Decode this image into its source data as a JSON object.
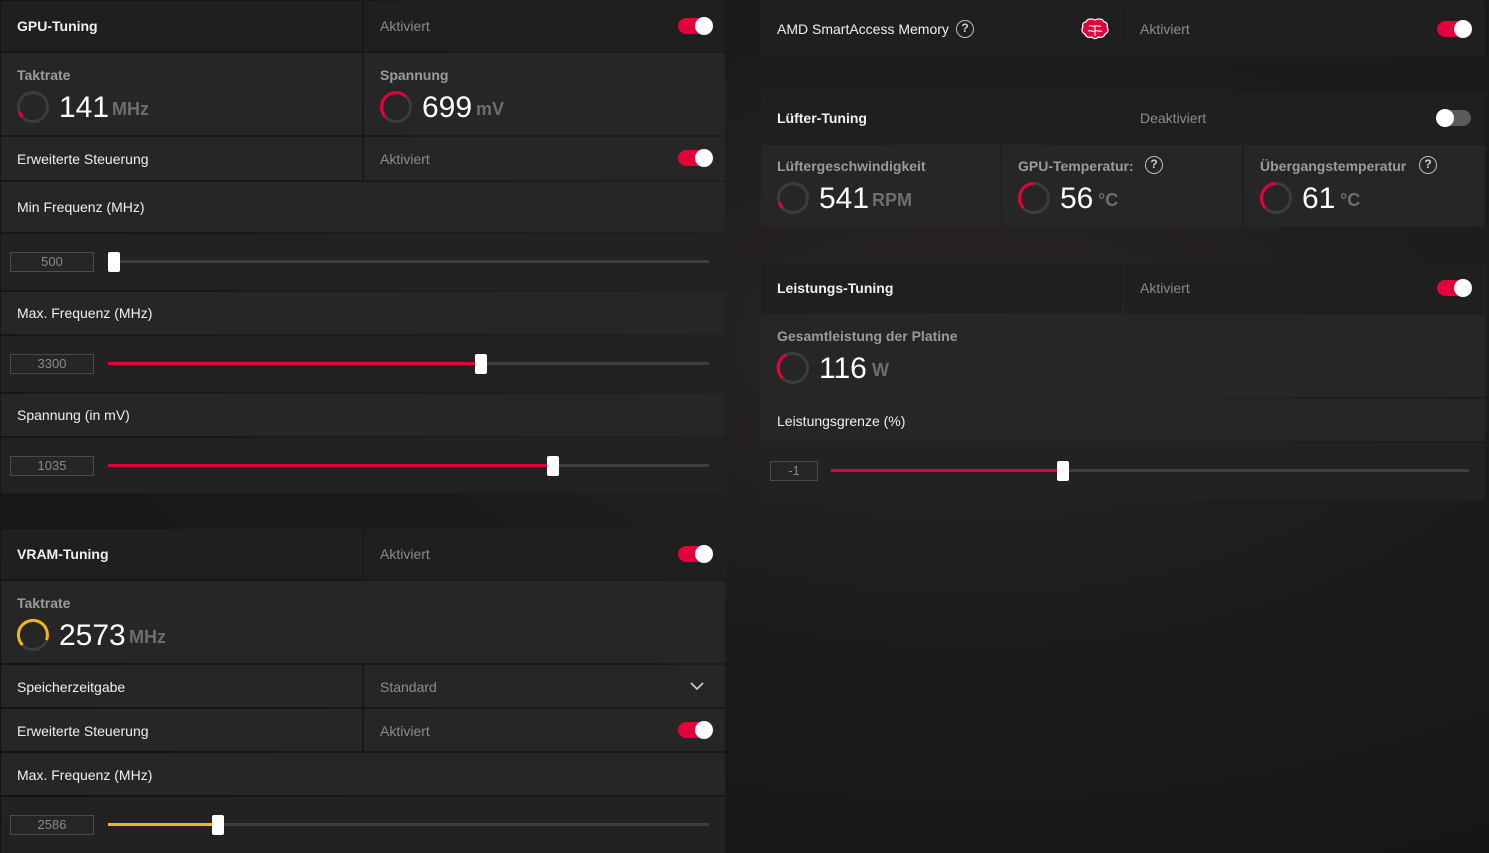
{
  "colors": {
    "accent_red": "#e4003a",
    "accent_yellow": "#f2b51d",
    "panel": "#262626"
  },
  "gpu_tuning": {
    "title": "GPU-Tuning",
    "status": "Aktiviert",
    "enabled": true,
    "clock": {
      "title": "Taktrate",
      "value": "141",
      "unit": "MHz"
    },
    "voltage": {
      "title": "Spannung",
      "value": "699",
      "unit": "mV"
    },
    "advanced": {
      "label": "Erweiterte Steuerung",
      "status": "Aktiviert",
      "enabled": true
    },
    "min_freq": {
      "label": "Min Frequenz (MHz)",
      "value": "500",
      "percent": 0
    },
    "max_freq": {
      "label": "Max. Frequenz (MHz)",
      "value": "3300",
      "percent": 62
    },
    "voltage_slider": {
      "label": "Spannung (in mV)",
      "value": "1035",
      "percent": 74
    }
  },
  "vram_tuning": {
    "title": "VRAM-Tuning",
    "status": "Aktiviert",
    "enabled": true,
    "clock": {
      "title": "Taktrate",
      "value": "2573",
      "unit": "MHz"
    },
    "memory_timing": {
      "label": "Speicherzeitgabe",
      "value": "Standard",
      "icon": "chevron-down-icon"
    },
    "advanced": {
      "label": "Erweiterte Steuerung",
      "status": "Aktiviert",
      "enabled": true
    },
    "max_freq": {
      "label": "Max. Frequenz (MHz)",
      "value": "2586",
      "percent": 18
    }
  },
  "smart_access": {
    "label": "AMD SmartAccess Memory",
    "help": "?",
    "icon": "brain-icon",
    "status": "Aktiviert",
    "enabled": true
  },
  "fan_tuning": {
    "title": "Lüfter-Tuning",
    "status": "Deaktiviert",
    "enabled": false,
    "fan_speed": {
      "title": "Lüftergeschwindigkeit",
      "value": "541",
      "unit": "RPM"
    },
    "gpu_temp": {
      "title": "GPU-Temperatur:",
      "help": "?",
      "value": "56",
      "unit": "°C"
    },
    "junction_temp": {
      "title": "Übergangstemperatur",
      "help": "?",
      "value": "61",
      "unit": "°C"
    }
  },
  "power_tuning": {
    "title": "Leistungs-Tuning",
    "status": "Aktiviert",
    "enabled": true,
    "board_power": {
      "title": "Gesamtleistung der Platine",
      "value": "116",
      "unit": "W"
    },
    "power_limit": {
      "label": "Leistungsgrenze (%)",
      "value": "-1",
      "percent": 36
    }
  }
}
